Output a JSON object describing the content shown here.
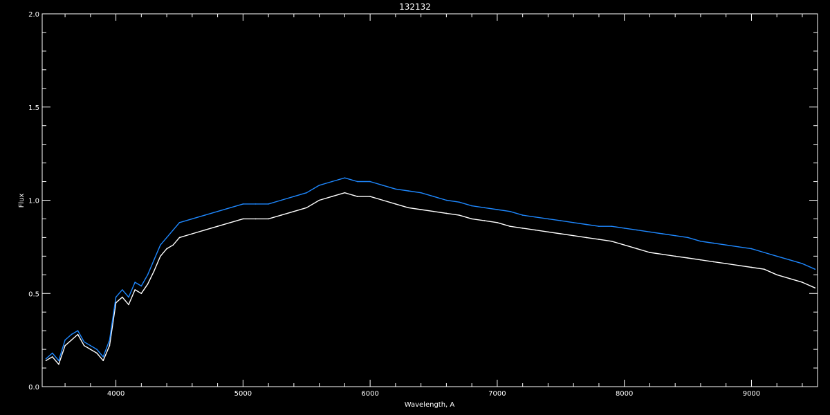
{
  "chart_data": {
    "type": "line",
    "title": "132132",
    "xlabel": "Wavelength, A",
    "ylabel": "Flux",
    "xlim": [
      3420,
      9520
    ],
    "ylim": [
      0.0,
      2.0
    ],
    "xticks": [
      4000,
      5000,
      6000,
      7000,
      8000,
      9000
    ],
    "xtick_labels": [
      "4000",
      "5000",
      "6000",
      "7000",
      "8000",
      "9000"
    ],
    "yticks": [
      0.0,
      0.5,
      1.0,
      1.5,
      2.0
    ],
    "ytick_labels": [
      "0.0",
      "0.5",
      "1.0",
      "1.5",
      "2.0"
    ],
    "grid": false,
    "colors": {
      "background": "#000000",
      "axes": "#ffffff",
      "series_white": "#ffffff",
      "series_blue": "#1e88ff"
    },
    "series": [
      {
        "color": "#ffffff",
        "x": [
          3450,
          3500,
          3550,
          3600,
          3650,
          3700,
          3750,
          3800,
          3850,
          3900,
          3950,
          4000,
          4050,
          4100,
          4150,
          4200,
          4250,
          4300,
          4350,
          4400,
          4450,
          4500,
          4600,
          4700,
          4800,
          4900,
          5000,
          5100,
          5200,
          5300,
          5400,
          5500,
          5600,
          5700,
          5800,
          5900,
          6000,
          6100,
          6200,
          6300,
          6400,
          6500,
          6600,
          6700,
          6800,
          6900,
          7000,
          7100,
          7200,
          7300,
          7400,
          7500,
          7600,
          7700,
          7800,
          7900,
          8000,
          8100,
          8200,
          8300,
          8400,
          8500,
          8600,
          8700,
          8800,
          8900,
          9000,
          9100,
          9200,
          9300,
          9400,
          9500
        ],
        "y": [
          0.14,
          0.16,
          0.12,
          0.22,
          0.25,
          0.28,
          0.22,
          0.2,
          0.18,
          0.14,
          0.22,
          0.45,
          0.48,
          0.44,
          0.52,
          0.5,
          0.55,
          0.62,
          0.7,
          0.74,
          0.76,
          0.8,
          0.82,
          0.84,
          0.86,
          0.88,
          0.9,
          0.9,
          0.9,
          0.92,
          0.94,
          0.96,
          1.0,
          1.02,
          1.04,
          1.02,
          1.02,
          1.0,
          0.98,
          0.96,
          0.95,
          0.94,
          0.93,
          0.92,
          0.9,
          0.89,
          0.88,
          0.86,
          0.85,
          0.84,
          0.83,
          0.82,
          0.81,
          0.8,
          0.79,
          0.78,
          0.76,
          0.74,
          0.72,
          0.71,
          0.7,
          0.69,
          0.68,
          0.67,
          0.66,
          0.65,
          0.64,
          0.63,
          0.6,
          0.58,
          0.56,
          0.53
        ]
      },
      {
        "color": "#1e88ff",
        "x": [
          3450,
          3500,
          3550,
          3600,
          3650,
          3700,
          3750,
          3800,
          3850,
          3900,
          3950,
          4000,
          4050,
          4100,
          4150,
          4200,
          4250,
          4300,
          4350,
          4400,
          4450,
          4500,
          4600,
          4700,
          4800,
          4900,
          5000,
          5100,
          5200,
          5300,
          5400,
          5500,
          5600,
          5700,
          5800,
          5900,
          6000,
          6100,
          6200,
          6300,
          6400,
          6500,
          6600,
          6700,
          6800,
          6900,
          7000,
          7100,
          7200,
          7300,
          7400,
          7500,
          7600,
          7700,
          7800,
          7900,
          8000,
          8100,
          8200,
          8300,
          8400,
          8500,
          8600,
          8700,
          8800,
          8900,
          9000,
          9100,
          9200,
          9300,
          9400,
          9500
        ],
        "y": [
          0.15,
          0.18,
          0.14,
          0.25,
          0.28,
          0.3,
          0.24,
          0.22,
          0.2,
          0.16,
          0.25,
          0.48,
          0.52,
          0.48,
          0.56,
          0.54,
          0.6,
          0.68,
          0.76,
          0.8,
          0.84,
          0.88,
          0.9,
          0.92,
          0.94,
          0.96,
          0.98,
          0.98,
          0.98,
          1.0,
          1.02,
          1.04,
          1.08,
          1.1,
          1.12,
          1.1,
          1.1,
          1.08,
          1.06,
          1.05,
          1.04,
          1.02,
          1.0,
          0.99,
          0.97,
          0.96,
          0.95,
          0.94,
          0.92,
          0.91,
          0.9,
          0.89,
          0.88,
          0.87,
          0.86,
          0.86,
          0.85,
          0.84,
          0.83,
          0.82,
          0.81,
          0.8,
          0.78,
          0.77,
          0.76,
          0.75,
          0.74,
          0.72,
          0.7,
          0.68,
          0.66,
          0.63
        ]
      }
    ]
  }
}
